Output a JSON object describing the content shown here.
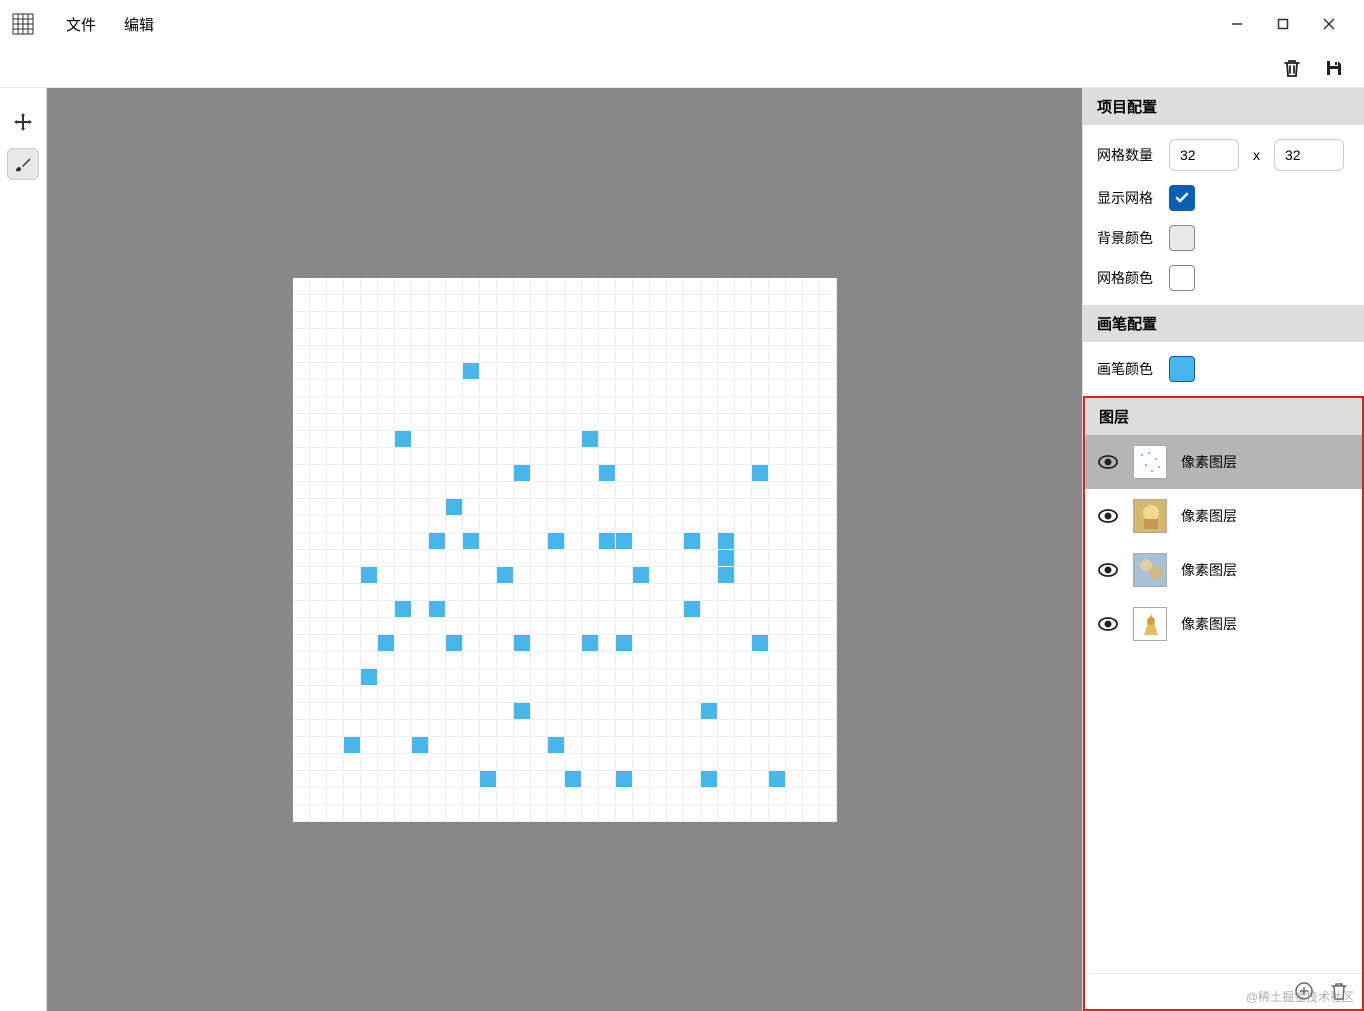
{
  "menu": {
    "file": "文件",
    "edit": "编辑"
  },
  "toolbar_icons": {
    "delete": "delete-icon",
    "save": "save-icon"
  },
  "tools": [
    {
      "name": "move",
      "active": false
    },
    {
      "name": "brush",
      "active": true
    }
  ],
  "canvas": {
    "grid_cols": 32,
    "grid_rows": 32,
    "cell_size": 17,
    "filled_cells": [
      [
        5,
        10
      ],
      [
        9,
        6
      ],
      [
        9,
        17
      ],
      [
        11,
        13
      ],
      [
        11,
        18
      ],
      [
        11,
        27
      ],
      [
        13,
        9
      ],
      [
        15,
        8
      ],
      [
        15,
        10
      ],
      [
        15,
        15
      ],
      [
        15,
        18
      ],
      [
        15,
        19
      ],
      [
        15,
        23
      ],
      [
        15,
        25
      ],
      [
        16,
        25
      ],
      [
        17,
        4
      ],
      [
        17,
        12
      ],
      [
        17,
        20
      ],
      [
        17,
        25
      ],
      [
        19,
        6
      ],
      [
        19,
        8
      ],
      [
        19,
        23
      ],
      [
        21,
        5
      ],
      [
        21,
        9
      ],
      [
        21,
        13
      ],
      [
        21,
        17
      ],
      [
        21,
        19
      ],
      [
        21,
        27
      ],
      [
        23,
        4
      ],
      [
        25,
        13
      ],
      [
        25,
        24
      ],
      [
        27,
        3
      ],
      [
        27,
        7
      ],
      [
        27,
        15
      ],
      [
        29,
        11
      ],
      [
        29,
        16
      ],
      [
        29,
        19
      ],
      [
        29,
        24
      ],
      [
        29,
        28
      ]
    ]
  },
  "project_config": {
    "title": "项目配置",
    "grid_count_label": "网格数量",
    "cols": "32",
    "rows": "32",
    "show_grid_label": "显示网格",
    "show_grid": true,
    "bg_color_label": "背景颜色",
    "grid_color_label": "网格颜色"
  },
  "brush_config": {
    "title": "画笔配置",
    "color_label": "画笔颜色"
  },
  "layers_panel": {
    "title": "图层",
    "layers": [
      {
        "name": "像素图层",
        "visible": true,
        "selected": true,
        "thumb": "dots"
      },
      {
        "name": "像素图层",
        "visible": true,
        "selected": false,
        "thumb": "img1"
      },
      {
        "name": "像素图层",
        "visible": true,
        "selected": false,
        "thumb": "img2"
      },
      {
        "name": "像素图层",
        "visible": true,
        "selected": false,
        "thumb": "img3"
      }
    ]
  },
  "watermark": "@稀土掘金技术社区"
}
